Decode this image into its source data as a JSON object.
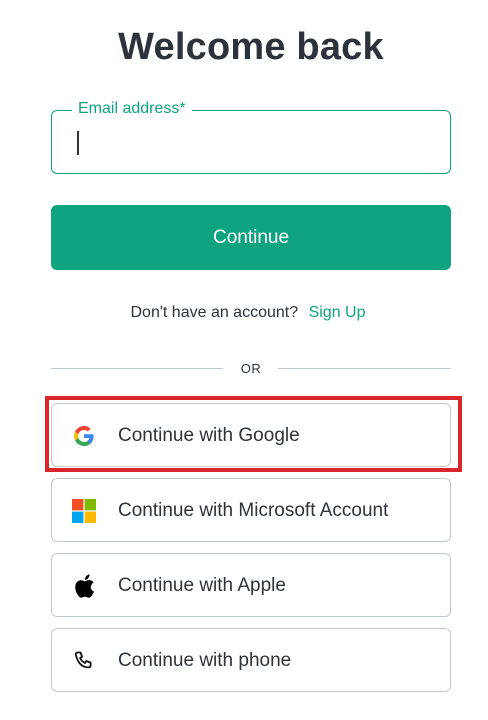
{
  "title": "Welcome back",
  "email": {
    "label": "Email address*",
    "value": ""
  },
  "continue_label": "Continue",
  "signup": {
    "prompt": "Don't have an account?",
    "link": "Sign Up"
  },
  "divider_text": "OR",
  "social": [
    {
      "label": "Continue with Google",
      "icon": "google-icon"
    },
    {
      "label": "Continue with Microsoft Account",
      "icon": "microsoft-icon"
    },
    {
      "label": "Continue with Apple",
      "icon": "apple-icon"
    },
    {
      "label": "Continue with phone",
      "icon": "phone-icon"
    }
  ],
  "colors": {
    "accent": "#10a37f",
    "highlight": "#d9252b",
    "text": "#2d333a",
    "border": "#c2c8d0"
  }
}
